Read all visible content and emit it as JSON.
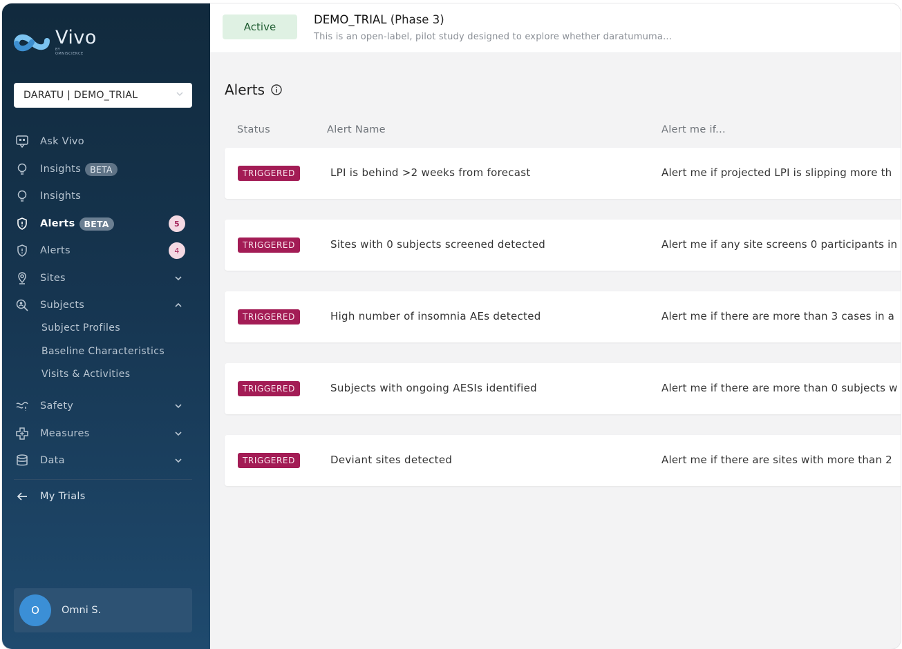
{
  "brand": {
    "name": "Vivo",
    "subtitle": "BY OMNISCIENCE"
  },
  "trial_selector": {
    "value": "DARATU | DEMO_TRIAL"
  },
  "nav": {
    "ask_vivo": "Ask Vivo",
    "insights_beta": {
      "label": "Insights",
      "badge": "BETA"
    },
    "insights": "Insights",
    "alerts_beta": {
      "label": "Alerts",
      "badge": "BETA",
      "count": "5"
    },
    "alerts": {
      "label": "Alerts",
      "count": "4"
    },
    "sites": "Sites",
    "subjects": "Subjects",
    "subjects_children": [
      "Subject Profiles",
      "Baseline Characteristics",
      "Visits & Activities"
    ],
    "safety": "Safety",
    "measures": "Measures",
    "data": "Data",
    "my_trials": "My Trials"
  },
  "user": {
    "initial": "O",
    "name": "Omni S."
  },
  "header": {
    "status": "Active",
    "trial_name": "DEMO_TRIAL",
    "phase": "(Phase 3)",
    "description": "This is an open-label, pilot study designed to explore whether daratumuma..."
  },
  "alerts_section": {
    "title": "Alerts",
    "columns": {
      "status": "Status",
      "name": "Alert Name",
      "condition": "Alert me if..."
    },
    "rows": [
      {
        "status": "TRIGGERED",
        "name": "LPI is behind >2 weeks from forecast",
        "condition": "Alert me if projected LPI is slipping more th"
      },
      {
        "status": "TRIGGERED",
        "name": "Sites with 0 subjects screened detected",
        "condition": "Alert me if any site screens 0 participants in"
      },
      {
        "status": "TRIGGERED",
        "name": "High number of insomnia AEs detected",
        "condition": "Alert me if there are more than 3 cases in a"
      },
      {
        "status": "TRIGGERED",
        "name": "Subjects with ongoing AESIs identified",
        "condition": "Alert me if there are more than 0 subjects w"
      },
      {
        "status": "TRIGGERED",
        "name": "Deviant sites detected",
        "condition": "Alert me if there are sites with more than 2"
      }
    ]
  },
  "colors": {
    "sidebar": "#163550",
    "triggered": "#a31c55",
    "active_pill": "#dff1e3",
    "badge_pink": "#f4d9e3"
  }
}
